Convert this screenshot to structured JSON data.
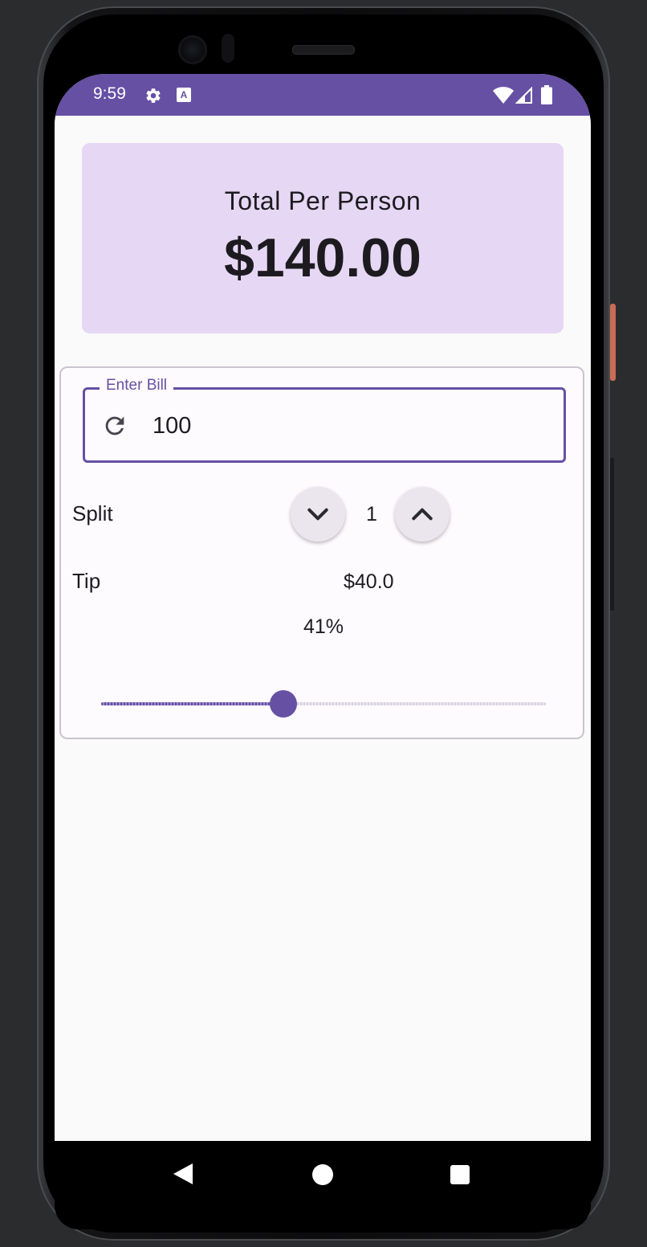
{
  "status_bar": {
    "time": "9:59",
    "icons": [
      "gear-icon",
      "keyboard-a-icon",
      "wifi-icon",
      "signal-icon",
      "battery-icon"
    ],
    "a_glyph": "A",
    "color": "#6650a4"
  },
  "header": {
    "title": "Total Per Person",
    "amount": "$140.00",
    "background": "#e6d8f4"
  },
  "bill": {
    "label": "Enter Bill",
    "value": "100",
    "icon": "refresh-icon"
  },
  "split": {
    "label": "Split",
    "count": "1",
    "decrement_icon": "chevron-down-icon",
    "increment_icon": "chevron-up-icon"
  },
  "tip": {
    "label": "Tip",
    "amount": "$40.0",
    "percent_label": "41%",
    "slider_fraction": 0.41
  },
  "nav": {
    "icons": [
      "back-icon",
      "home-icon",
      "recents-icon"
    ]
  },
  "theme": {
    "primary": "#6650a4",
    "on_surface": "#1d1b20",
    "outline": "#cac4d0"
  }
}
